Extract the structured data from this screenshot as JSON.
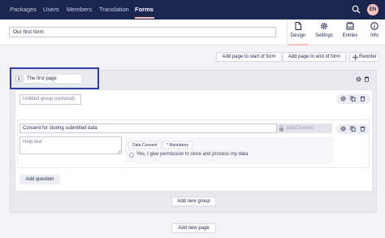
{
  "nav": {
    "items": [
      "Packages",
      "Users",
      "Members",
      "Translation",
      "Forms"
    ],
    "active": "Forms",
    "avatar_initials": "EN"
  },
  "form": {
    "name": "Our first form"
  },
  "app_tabs": [
    {
      "label": "Design",
      "icon": "document-icon",
      "active": true
    },
    {
      "label": "Settings",
      "icon": "gear-icon"
    },
    {
      "label": "Entries",
      "icon": "inbox-icon"
    },
    {
      "label": "Info",
      "icon": "info-icon"
    }
  ],
  "toolbar": {
    "add_start": "Add page to start of form",
    "add_end": "Add page to end of form",
    "reorder": "Reorder"
  },
  "page": {
    "number": "1",
    "title": "The first page",
    "group_placeholder": "Untitled group (optional)",
    "question": {
      "title": "Consent for storing submitted data",
      "alias": "dataConsent",
      "help_placeholder": "Help text",
      "type_tag": "Data Consent",
      "mandatory_tag": "* Mandatory",
      "consent_text": "Yes, I give permission to store and process my data"
    },
    "add_question": "Add question",
    "add_group": "Add new group"
  },
  "add_page": "Add new page",
  "colors": {
    "navbar": "#1b264f",
    "accent": "#f5c1bc",
    "highlight": "#2e3ba0"
  }
}
